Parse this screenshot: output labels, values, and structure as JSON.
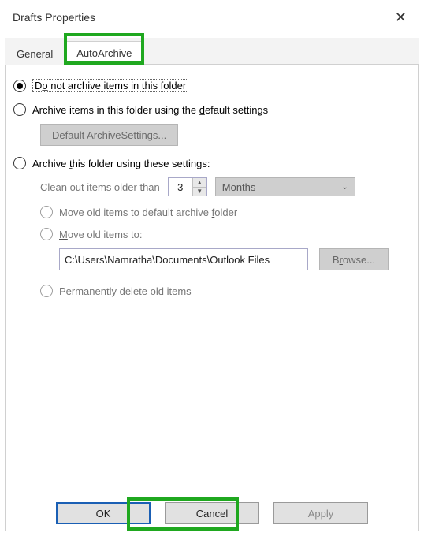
{
  "title": "Drafts Properties",
  "tabs": {
    "general": "General",
    "autoarchive": "AutoArchive"
  },
  "options": {
    "do_not_archive": "Do not archive items in this folder",
    "archive_default": "Archive items in this folder using the default settings",
    "default_settings_btn": "Default Archive Settings...",
    "archive_custom": "Archive this folder using these settings:",
    "clean_out_label": "Clean out items older than",
    "clean_out_value": "3",
    "clean_out_unit": "Months",
    "move_default": "Move old items to default archive folder",
    "move_to": "Move old items to:",
    "move_to_path": "C:\\Users\\Namratha\\Documents\\Outlook Files",
    "browse_btn": "Browse...",
    "perm_delete": "Permanently delete old items"
  },
  "buttons": {
    "ok": "OK",
    "cancel": "Cancel",
    "apply": "Apply"
  }
}
